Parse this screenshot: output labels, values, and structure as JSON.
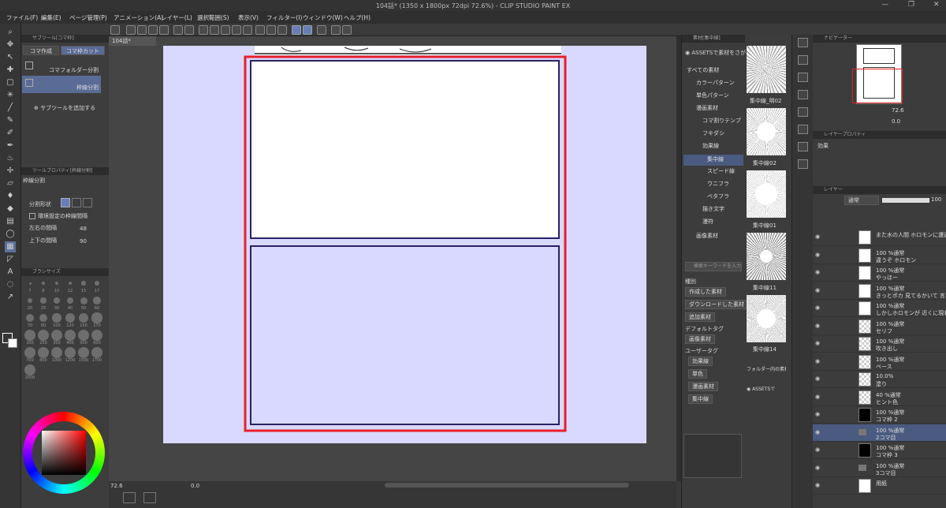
{
  "window": {
    "title": "104話* (1350 x 1800px 72dpi 72.6%) - CLIP STUDIO PAINT EX",
    "controls": [
      "—",
      "❐",
      "✕"
    ]
  },
  "menu": [
    "ファイル(F)",
    "編集(E)",
    "ページ管理(P)",
    "アニメーション(A)",
    "レイヤー(L)",
    "選択範囲(S)",
    "表示(V)",
    "フィルター(I)",
    "ウィンドウ(W)",
    "ヘルプ(H)"
  ],
  "canvas": {
    "tab_label": "104話*",
    "zoom": "72.6",
    "angle": "0.0",
    "panel_border_color": "#e8202c",
    "frame_color": "#2b2163"
  },
  "subtool": {
    "header": "サブツール[コマ枠]",
    "tabs": [
      "コマ作成",
      "コマ枠カット"
    ],
    "items": [
      "コマフォルダー分割",
      "枠線分割"
    ],
    "add_label": "サブツールを追加する"
  },
  "tool_property": {
    "header": "ツールプロパティ[枠線分割]",
    "title": "枠線分割",
    "split_shape_label": "分割形状",
    "env_checkbox_label": "環境設定の枠線間隔",
    "lr_gap_label": "左右の間隔",
    "lr_gap_value": "48",
    "tb_gap_label": "上下の間隔",
    "tb_gap_value": "90"
  },
  "brush_size": {
    "header": "ブラシサイズ",
    "sizes": [
      "7",
      "8",
      "10",
      "12",
      "15",
      "17",
      "20",
      "25",
      "30",
      "40",
      "50",
      "60",
      "70",
      "80",
      "100",
      "120",
      "150",
      "170",
      "200",
      "250",
      "300",
      "400",
      "500",
      "600",
      "700",
      "800",
      "1000",
      "1200",
      "1500",
      "1700",
      "2000"
    ]
  },
  "color": {
    "main": "#000000",
    "sub": "#ffffff",
    "wheel_selected": "#ff3030"
  },
  "materials": {
    "header": "素材[集中線]",
    "assets_label": "ASSETSで素材をさがす",
    "tree": [
      "すべての素材",
      "カラーパターン",
      "単色パターン",
      "漫画素材",
      "コマ割りテンプ",
      "フキダシ",
      "効果線",
      "集中線",
      "スピード線",
      "ウニフラ",
      "ベタフラ",
      "描き文字",
      "漫符",
      "画像素材"
    ],
    "search_placeholder": "検索キーワードを入力",
    "kind_label": "種別",
    "kind_tags": [
      "作成した素材",
      "ダウンロードした素材",
      "追加素材"
    ],
    "default_tag_label": "デフォルトタグ",
    "default_tags": [
      "画像素材"
    ],
    "user_tag_label": "ユーザータグ",
    "user_tags": [
      "効果線",
      "単色",
      "漫画素材",
      "集中線"
    ],
    "thumbs": [
      "集中線_明02",
      "集中線02",
      "集中線01",
      "集中線11",
      "集中線14"
    ],
    "folder_note": "フォルダー内の素材",
    "assets_short": "ASSETSで"
  },
  "navigator": {
    "header": "ナビゲーター",
    "zoom": "72.6",
    "angle": "0.0"
  },
  "layer_property": {
    "header": "レイヤープロパティ",
    "effect_label": "効果"
  },
  "layer_panel": {
    "header": "レイヤー",
    "blend_mode": "通常",
    "opacity": "100",
    "layers": [
      {
        "line1": "また水の人間 ホロモンに遭遇ここ",
        "line2": "",
        "kind": "text"
      },
      {
        "line1": "100 %通常",
        "line2": "違うぞ ホロモン",
        "kind": "text"
      },
      {
        "line1": "100 %通常",
        "line2": "やっほー",
        "kind": "text"
      },
      {
        "line1": "100 %通常",
        "line2": "きっとポカ 見てるかいて 言ったか",
        "kind": "text"
      },
      {
        "line1": "100 %通常",
        "line2": "しかしホロモンが 近くに現れ",
        "kind": "text"
      },
      {
        "line1": "100 %通常",
        "line2": "セリフ",
        "kind": "raster"
      },
      {
        "line1": "100 %通常",
        "line2": "吹き出し",
        "kind": "raster"
      },
      {
        "line1": "100 %通常",
        "line2": "ベース",
        "kind": "raster"
      },
      {
        "line1": "10.0% ",
        "line2": "塗り",
        "kind": "raster"
      },
      {
        "line1": "40 %通常",
        "line2": "ヒント色",
        "kind": "raster"
      },
      {
        "line1": "100 %通常",
        "line2": "コマ枠 2",
        "kind": "frame"
      },
      {
        "line1": "100 %通常",
        "line2": "2コマ目",
        "kind": "folder",
        "selected": true
      },
      {
        "line1": "100 %通常",
        "line2": "コマ枠 3",
        "kind": "frame"
      },
      {
        "line1": "100 %通常",
        "line2": "3コマ目",
        "kind": "folder"
      },
      {
        "line1": "用紙",
        "line2": "",
        "kind": "paper"
      }
    ]
  }
}
